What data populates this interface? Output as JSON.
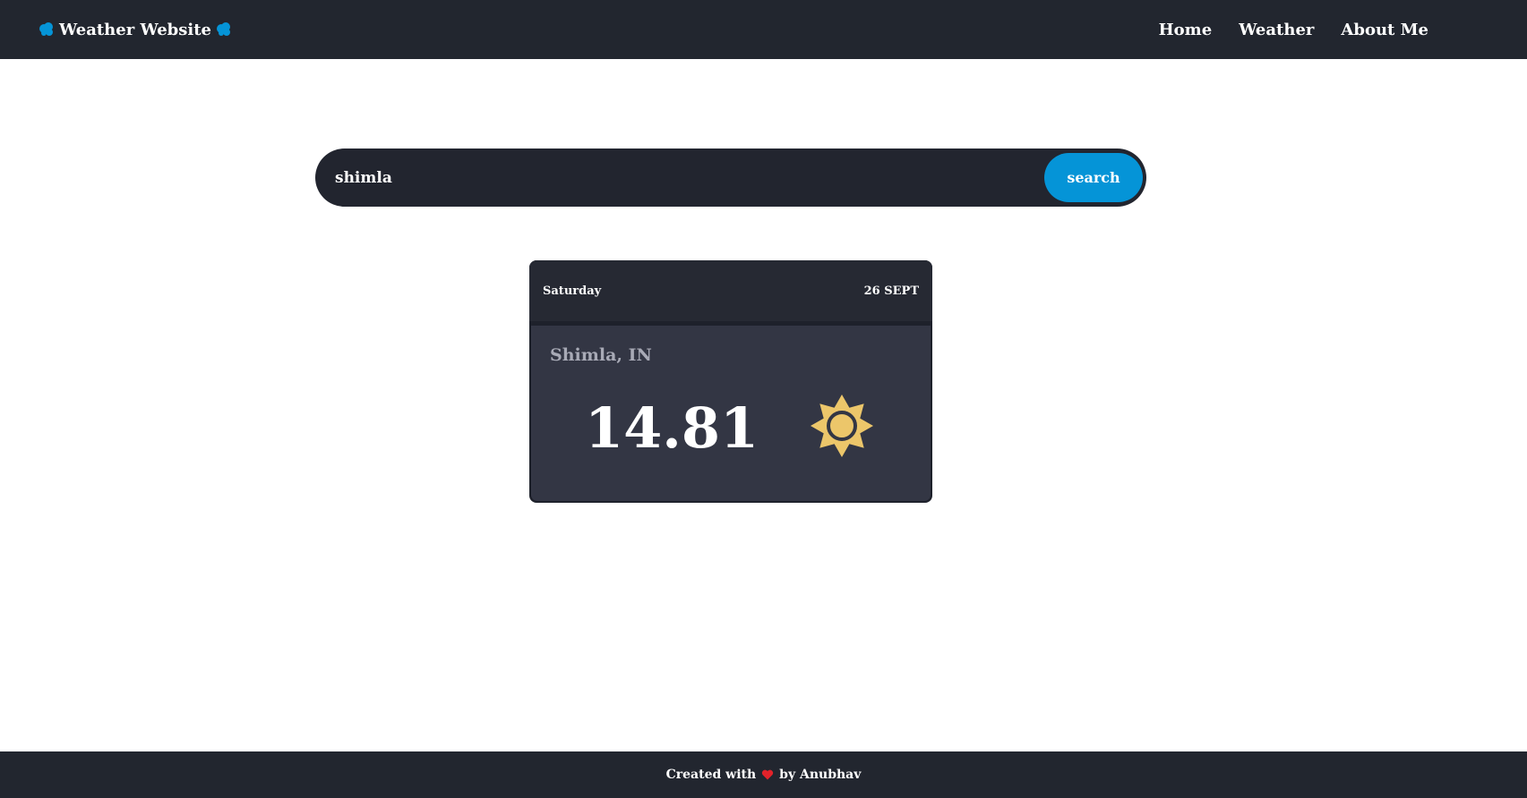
{
  "navbar": {
    "brand": "Weather Website",
    "brand_icon": "cloud-icon",
    "links": [
      "Home",
      "Weather",
      "About Me"
    ]
  },
  "search": {
    "value": "shimla",
    "button_label": "search"
  },
  "card": {
    "day": "Saturday",
    "date": "26 SEPT",
    "city": "Shimla, IN",
    "temperature": "14.81",
    "condition_icon": "sun-icon"
  },
  "footer": {
    "text_before": "Created with",
    "icon": "heart-icon",
    "text_after": "by Anubhav"
  },
  "colors": {
    "nav_bg": "#22262f",
    "accent": "#0594d7",
    "card_bg": "#333644",
    "sun": "#ecc66a"
  }
}
